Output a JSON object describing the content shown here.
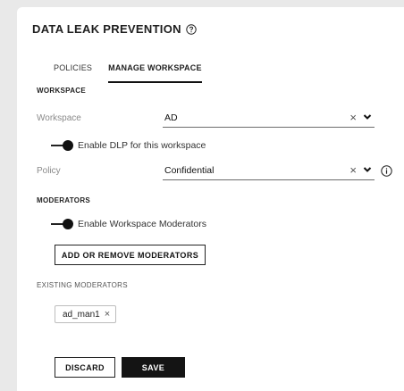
{
  "header": {
    "title": "DATA LEAK PREVENTION",
    "help_icon": "question-circle-icon"
  },
  "tabs": [
    {
      "label": "POLICIES",
      "active": false
    },
    {
      "label": "MANAGE WORKSPACE",
      "active": true
    }
  ],
  "workspace_section": {
    "heading": "WORKSPACE",
    "workspace_label": "Workspace",
    "workspace_value": "AD",
    "dlp_toggle": {
      "label": "Enable DLP for this workspace",
      "on": true
    },
    "policy_label": "Policy",
    "policy_value": "Confidential"
  },
  "moderators_section": {
    "heading": "MODERATORS",
    "moderators_toggle": {
      "label": "Enable Workspace Moderators",
      "on": true
    },
    "add_remove_label": "ADD OR REMOVE MODERATORS",
    "existing_heading": "EXISTING MODERATORS",
    "existing": [
      "ad_man1"
    ]
  },
  "footer": {
    "discard_label": "DISCARD",
    "save_label": "SAVE"
  },
  "icons": {
    "clear": "close-icon",
    "dropdown": "chevron-down-icon",
    "info": "info-circle-icon"
  },
  "colors": {
    "accent": "#141414",
    "background": "#e9e9e9",
    "panel": "#ffffff"
  }
}
